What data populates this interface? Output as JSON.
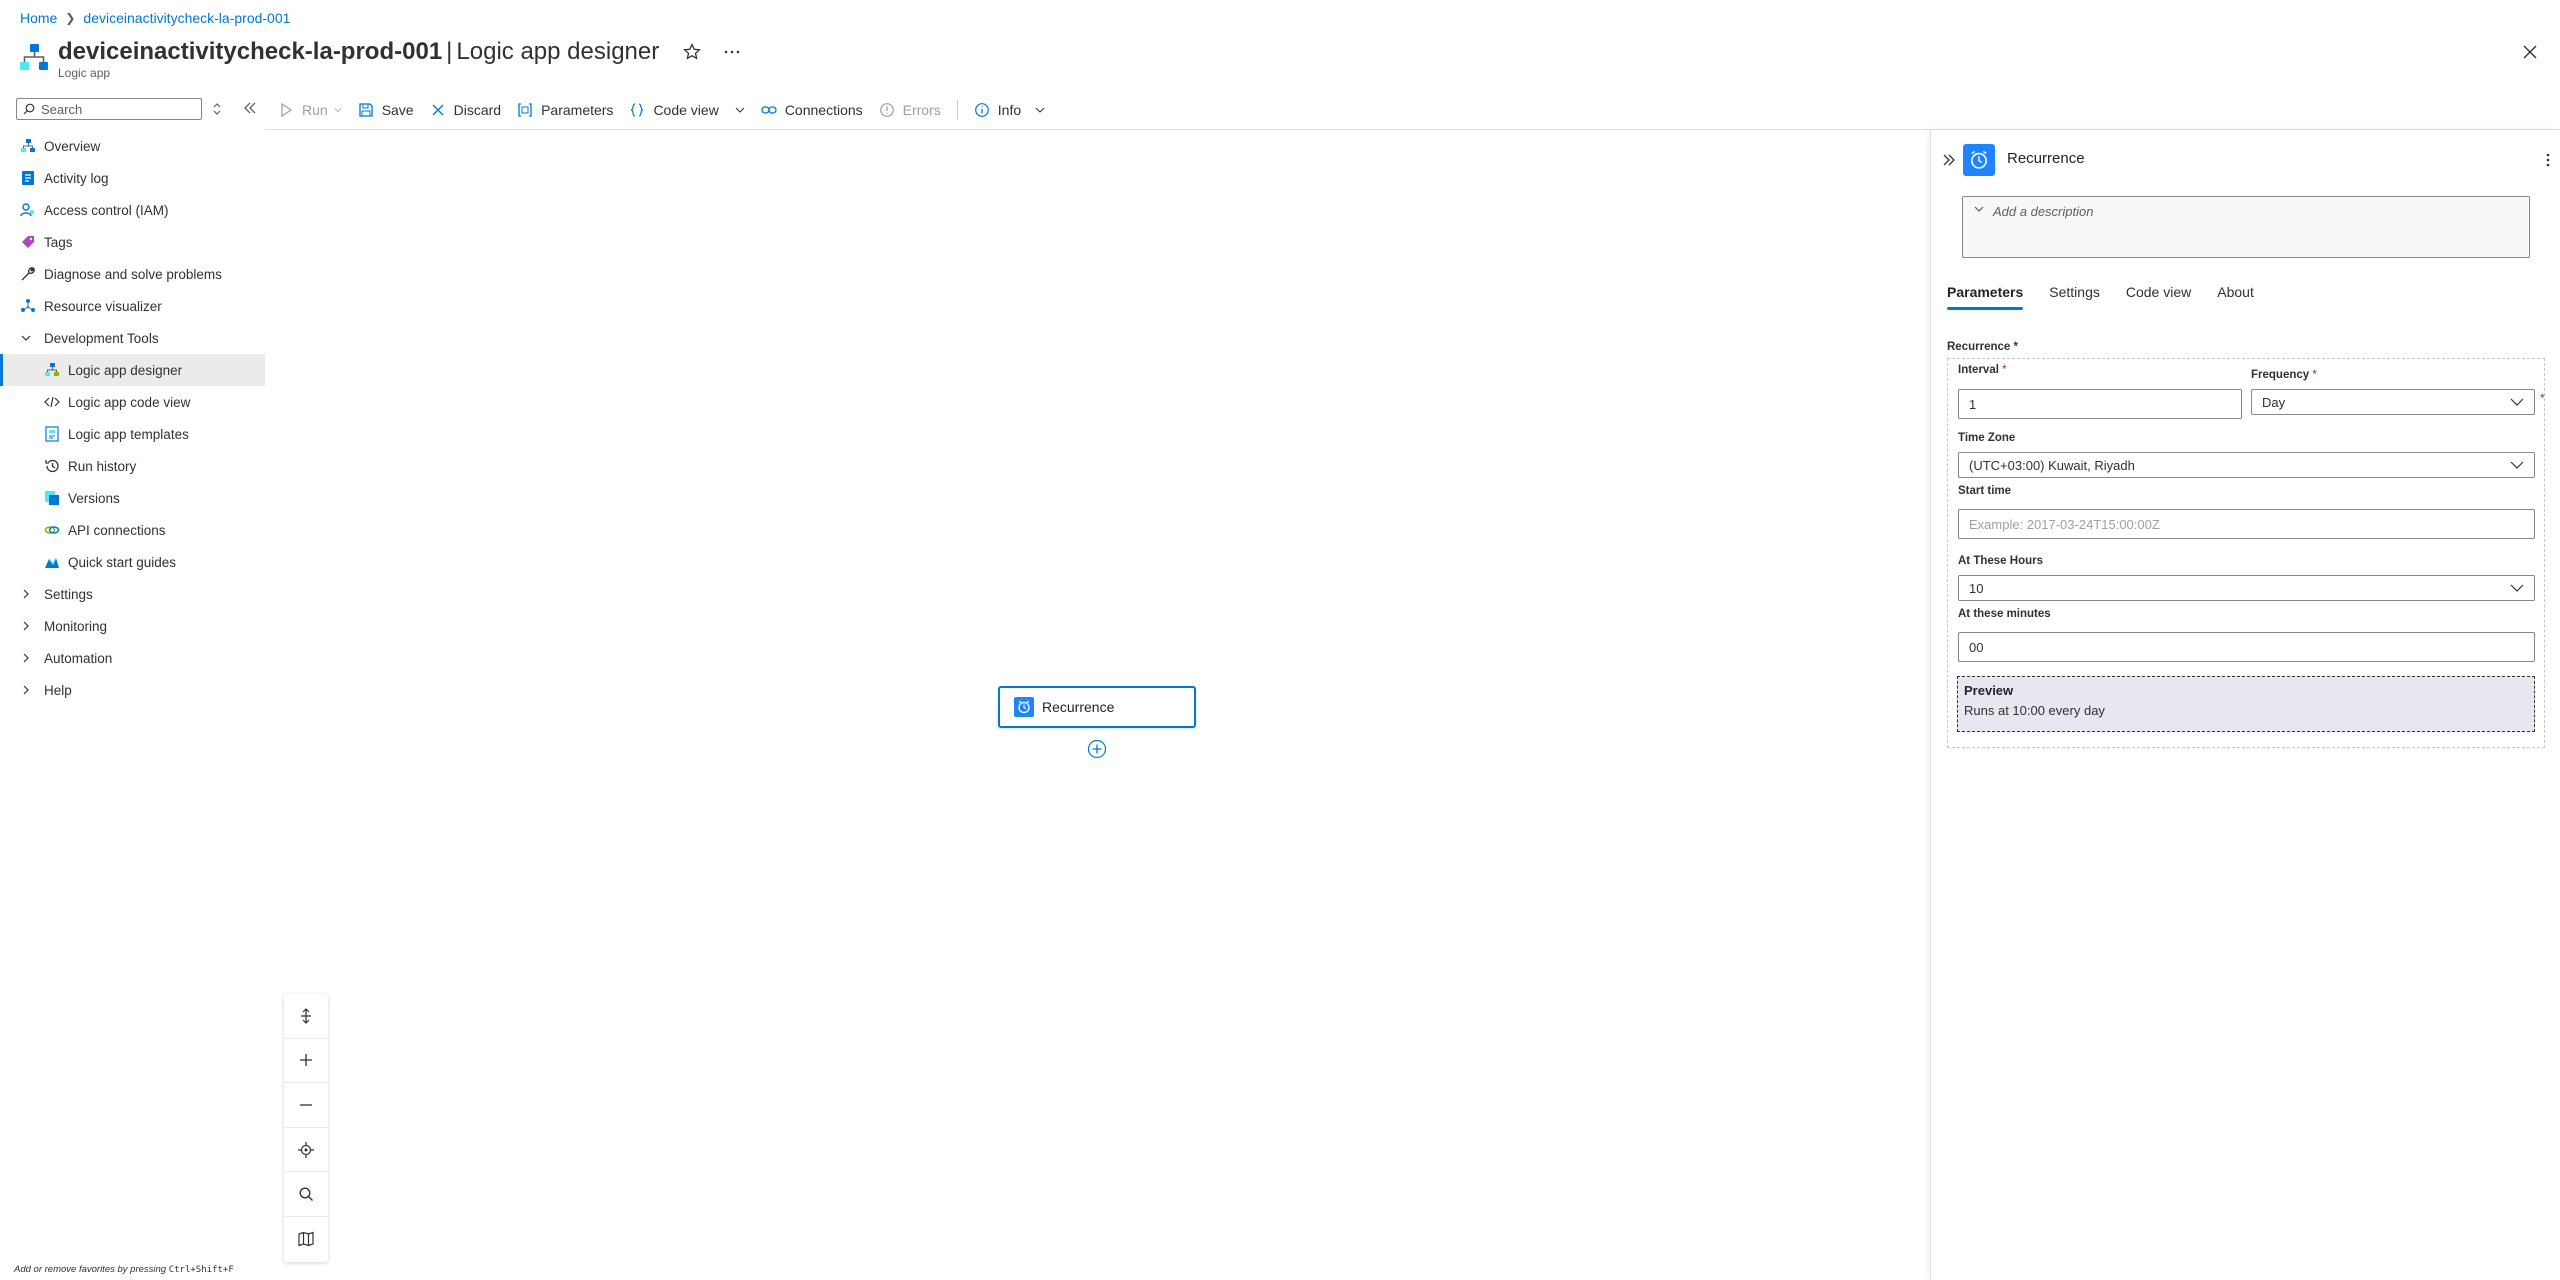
{
  "breadcrumb": {
    "home": "Home",
    "resource": "deviceinactivitycheck-la-prod-001"
  },
  "header": {
    "resource_name": "deviceinactivitycheck-la-prod-001",
    "separator": "|",
    "page_title": "Logic app designer",
    "subtitle": "Logic app"
  },
  "sidebar": {
    "search_placeholder": "Search",
    "items": [
      {
        "label": "Overview",
        "icon": "logic-app-icon"
      },
      {
        "label": "Activity log",
        "icon": "activity-log-icon"
      },
      {
        "label": "Access control (IAM)",
        "icon": "iam-icon"
      },
      {
        "label": "Tags",
        "icon": "tag-icon"
      },
      {
        "label": "Diagnose and solve problems",
        "icon": "wrench-icon"
      },
      {
        "label": "Resource visualizer",
        "icon": "visualizer-icon"
      }
    ],
    "dev_tools_group": "Development Tools",
    "dev_tools": [
      {
        "label": "Logic app designer",
        "icon": "designer-icon",
        "selected": true
      },
      {
        "label": "Logic app code view",
        "icon": "code-icon"
      },
      {
        "label": "Logic app templates",
        "icon": "templates-icon"
      },
      {
        "label": "Run history",
        "icon": "history-icon"
      },
      {
        "label": "Versions",
        "icon": "versions-icon"
      },
      {
        "label": "API connections",
        "icon": "connections-icon"
      },
      {
        "label": "Quick start guides",
        "icon": "quickstart-icon"
      }
    ],
    "groups": [
      "Settings",
      "Monitoring",
      "Automation",
      "Help"
    ],
    "favorites_hint": "Add or remove favorites by pressing",
    "favorites_keys": "Ctrl+Shift+F"
  },
  "toolbar": {
    "run": "Run",
    "save": "Save",
    "discard": "Discard",
    "parameters": "Parameters",
    "code_view": "Code view",
    "connections": "Connections",
    "errors": "Errors",
    "info": "Info"
  },
  "canvas": {
    "trigger_label": "Recurrence"
  },
  "panel": {
    "title": "Recurrence",
    "description_placeholder": "Add a description",
    "tabs": [
      "Parameters",
      "Settings",
      "Code view",
      "About"
    ],
    "active_tab": "Parameters",
    "recurrence_label": "Recurrence",
    "interval_label": "Interval",
    "interval_value": "1",
    "frequency_label": "Frequency",
    "frequency_value": "Day",
    "timezone_label": "Time Zone",
    "timezone_value": "(UTC+03:00) Kuwait, Riyadh",
    "start_time_label": "Start time",
    "start_time_placeholder": "Example: 2017-03-24T15:00:00Z",
    "hours_label": "At These Hours",
    "hours_value": "10",
    "minutes_label": "At these minutes",
    "minutes_value": "00",
    "preview_title": "Preview",
    "preview_text": "Runs at 10:00 every day",
    "required_mark": "*"
  },
  "colors": {
    "accent": "#0078d4",
    "trigger": "#1f85ff",
    "selected_bg": "#edebe9"
  }
}
